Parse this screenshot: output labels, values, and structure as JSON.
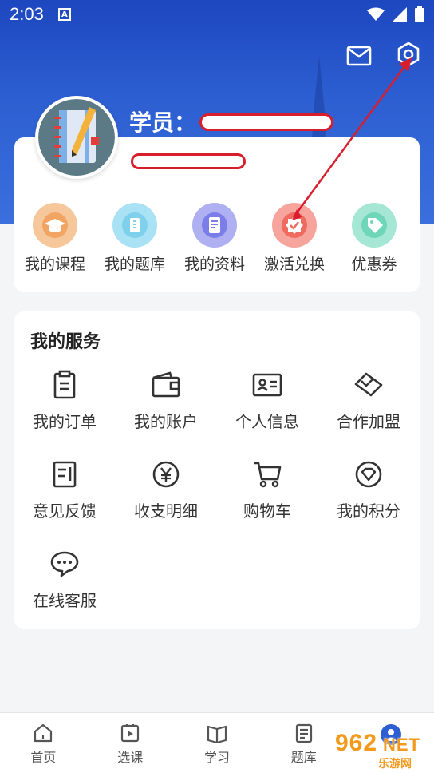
{
  "status_bar": {
    "time": "2:03",
    "badge": "A"
  },
  "header": {
    "mail_icon": "mail-icon",
    "settings_icon": "gear-icon"
  },
  "profile": {
    "name_prefix": "学员："
  },
  "quick_actions": [
    {
      "label": "我的课程",
      "icon": "graduation-cap-icon",
      "color": "#f2a463"
    },
    {
      "label": "我的题库",
      "icon": "ticket-icon",
      "color": "#7fd0ec"
    },
    {
      "label": "我的资料",
      "icon": "document-icon",
      "color": "#7b7ee8"
    },
    {
      "label": "激活兑换",
      "icon": "badge-check-icon",
      "color": "#ef6b5f"
    },
    {
      "label": "优惠券",
      "icon": "coupon-tag-icon",
      "color": "#6fd6b9"
    }
  ],
  "services": {
    "title": "我的服务",
    "items": [
      {
        "label": "我的订单",
        "icon": "clipboard-icon"
      },
      {
        "label": "我的账户",
        "icon": "wallet-icon"
      },
      {
        "label": "个人信息",
        "icon": "id-card-icon"
      },
      {
        "label": "合作加盟",
        "icon": "handshake-icon"
      },
      {
        "label": "意见反馈",
        "icon": "feedback-icon"
      },
      {
        "label": "收支明细",
        "icon": "yen-icon"
      },
      {
        "label": "购物车",
        "icon": "cart-icon"
      },
      {
        "label": "我的积分",
        "icon": "points-icon"
      },
      {
        "label": "在线客服",
        "icon": "chat-icon"
      }
    ]
  },
  "bottom_nav": [
    {
      "label": "首页",
      "icon": "home-icon"
    },
    {
      "label": "选课",
      "icon": "play-course-icon"
    },
    {
      "label": "学习",
      "icon": "book-icon"
    },
    {
      "label": "题库",
      "icon": "question-bank-icon"
    },
    {
      "label": "",
      "icon": "profile-icon"
    }
  ],
  "watermark": {
    "number": "962",
    "suffix": "NET",
    "site": "乐游网"
  },
  "colors": {
    "header_blue": "#2d5fd2",
    "annotation_red": "#d81e2c",
    "watermark_orange": "#f39a1d"
  }
}
